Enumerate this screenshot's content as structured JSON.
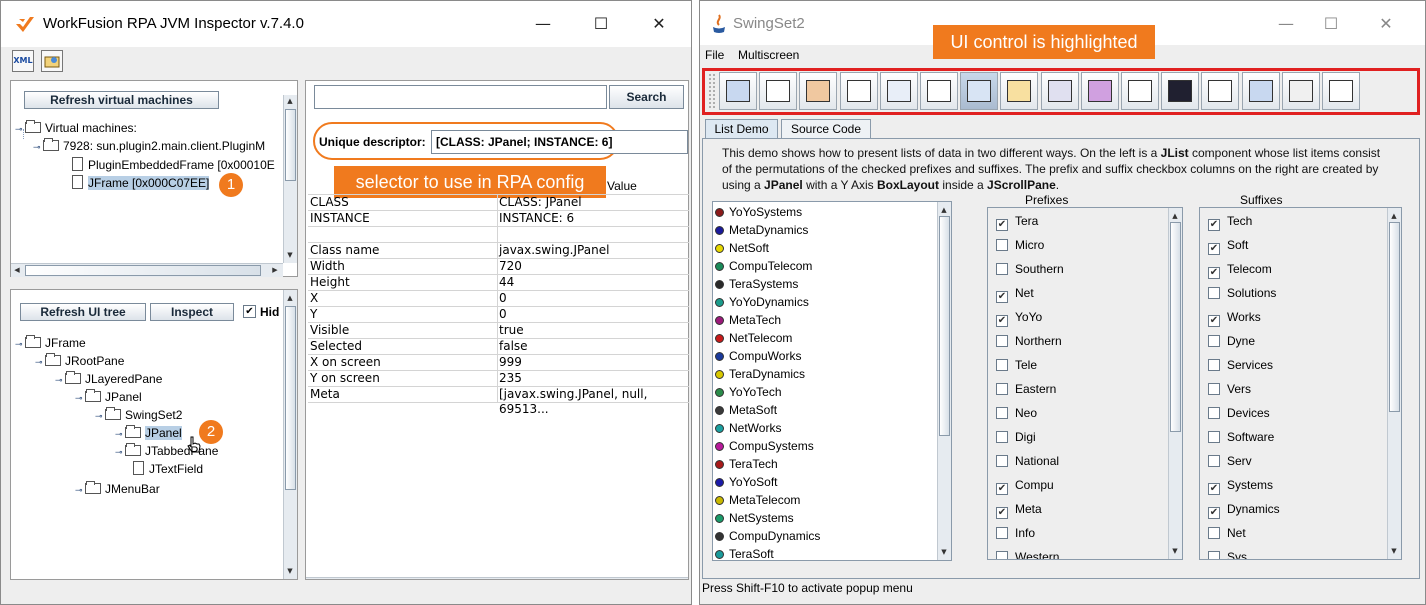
{
  "inspector": {
    "title": "WorkFusion RPA JVM Inspector v.7.4.0",
    "controls": {
      "minimize": "—",
      "maximize": "☐",
      "close": "✕"
    },
    "toolbar": {
      "xml_label": "XML",
      "open_label": ""
    },
    "vm_panel": {
      "refresh_vm_button": "Refresh virtual machines",
      "tree": [
        "Virtual machines:",
        "7928: sun.plugin2.main.client.PluginM",
        "PluginEmbeddedFrame [0x00010E",
        "JFrame [0x000C07EE]"
      ]
    },
    "ui_panel": {
      "refresh_ui_button": "Refresh UI tree",
      "inspect_button": "Inspect",
      "hide_checkbox_label": "Hid",
      "hide_checked": true,
      "tree": [
        "JFrame",
        "JRootPane",
        "JLayeredPane",
        "JPanel",
        "SwingSet2",
        "JPanel",
        "JTabbedPane",
        "JTextField",
        "JMenuBar"
      ]
    },
    "search": {
      "value": "",
      "button": "Search"
    },
    "descriptor": {
      "label": "Unique descriptor:",
      "value": "[CLASS: JPanel; INSTANCE: 6]"
    },
    "value_header": "Value",
    "properties": [
      {
        "key": "CLASS",
        "value": "CLASS: JPanel"
      },
      {
        "key": "INSTANCE",
        "value": "INSTANCE: 6"
      },
      {
        "key": "",
        "value": ""
      },
      {
        "key": "Class name",
        "value": "javax.swing.JPanel"
      },
      {
        "key": "Width",
        "value": "720"
      },
      {
        "key": "Height",
        "value": "44"
      },
      {
        "key": "X",
        "value": "0"
      },
      {
        "key": "Y",
        "value": "0"
      },
      {
        "key": "Visible",
        "value": "true"
      },
      {
        "key": "Selected",
        "value": "false"
      },
      {
        "key": "X on screen",
        "value": "999"
      },
      {
        "key": "Y on screen",
        "value": "235"
      },
      {
        "key": "Meta",
        "value": "[javax.swing.JPanel, null, 69513..."
      }
    ]
  },
  "annotations": {
    "badge1": "1",
    "badge2": "2",
    "selector_callout": "selector to use in RPA config",
    "highlight_callout": "UI control is highlighted",
    "accent_color": "#f07a1e",
    "highlight_color": "#e02020"
  },
  "swingset": {
    "title": "SwingSet2",
    "menu": [
      "File",
      "Multiscreen"
    ],
    "toolbar_icons": [
      "internal-frame-icon",
      "button-icon",
      "color-chooser-icon",
      "combobox-icon",
      "file-chooser-icon",
      "editor-pane-icon",
      "list-icon",
      "option-pane-icon",
      "progress-bar-icon",
      "scroll-pane-icon",
      "slider-icon",
      "split-pane-icon",
      "tabbed-pane-icon",
      "table-icon",
      "tooltip-icon",
      "tree-icon"
    ],
    "tabs": [
      "List Demo",
      "Source Code"
    ],
    "description_parts": [
      "This demo shows how to present lists of data in two different ways. On the left is a ",
      "JList",
      " component whose list items consist of the permutations of the checked prefixes and suffixes. The prefix and suffix checkbox columns on the right are created by using a ",
      "JPanel",
      " with a Y Axis ",
      "BoxLayout",
      " inside a ",
      "JScrollPane",
      "."
    ],
    "list_items": [
      {
        "label": "YoYoSystems",
        "color": "#8b1a1a"
      },
      {
        "label": "MetaDynamics",
        "color": "#1a1a9b"
      },
      {
        "label": "NetSoft",
        "color": "#e6d800"
      },
      {
        "label": "CompuTelecom",
        "color": "#1a8b5a"
      },
      {
        "label": "TeraSystems",
        "color": "#2a2a2a"
      },
      {
        "label": "YoYoDynamics",
        "color": "#1a9b8b"
      },
      {
        "label": "MetaTech",
        "color": "#9b1a7a"
      },
      {
        "label": "NetTelecom",
        "color": "#c81a1a"
      },
      {
        "label": "CompuWorks",
        "color": "#1a3a9b"
      },
      {
        "label": "TeraDynamics",
        "color": "#d8c800"
      },
      {
        "label": "YoYoTech",
        "color": "#2a8b4a"
      },
      {
        "label": "MetaSoft",
        "color": "#3a3a3a"
      },
      {
        "label": "NetWorks",
        "color": "#1aa0a0"
      },
      {
        "label": "CompuSystems",
        "color": "#b81a9b"
      },
      {
        "label": "TeraTech",
        "color": "#a81a1a"
      },
      {
        "label": "YoYoSoft",
        "color": "#1a1aa8"
      },
      {
        "label": "MetaTelecom",
        "color": "#c8b800"
      },
      {
        "label": "NetSystems",
        "color": "#1a9b6a"
      },
      {
        "label": "CompuDynamics",
        "color": "#333333"
      },
      {
        "label": "TeraSoft",
        "color": "#1a9b9b"
      }
    ],
    "prefixes_header": "Prefixes",
    "suffixes_header": "Suffixes",
    "prefixes": [
      {
        "label": "Tera",
        "checked": true
      },
      {
        "label": "Micro",
        "checked": false
      },
      {
        "label": "Southern",
        "checked": false
      },
      {
        "label": "Net",
        "checked": true
      },
      {
        "label": "YoYo",
        "checked": true
      },
      {
        "label": "Northern",
        "checked": false
      },
      {
        "label": "Tele",
        "checked": false
      },
      {
        "label": "Eastern",
        "checked": false
      },
      {
        "label": "Neo",
        "checked": false
      },
      {
        "label": "Digi",
        "checked": false
      },
      {
        "label": "National",
        "checked": false
      },
      {
        "label": "Compu",
        "checked": true
      },
      {
        "label": "Meta",
        "checked": true
      },
      {
        "label": "Info",
        "checked": false
      },
      {
        "label": "Western",
        "checked": false
      }
    ],
    "suffixes": [
      {
        "label": "Tech",
        "checked": true
      },
      {
        "label": "Soft",
        "checked": true
      },
      {
        "label": "Telecom",
        "checked": true
      },
      {
        "label": "Solutions",
        "checked": false
      },
      {
        "label": "Works",
        "checked": true
      },
      {
        "label": "Dyne",
        "checked": false
      },
      {
        "label": "Services",
        "checked": false
      },
      {
        "label": "Vers",
        "checked": false
      },
      {
        "label": "Devices",
        "checked": false
      },
      {
        "label": "Software",
        "checked": false
      },
      {
        "label": "Serv",
        "checked": false
      },
      {
        "label": "Systems",
        "checked": true
      },
      {
        "label": "Dynamics",
        "checked": true
      },
      {
        "label": "Net",
        "checked": false
      },
      {
        "label": "Sys",
        "checked": false
      }
    ],
    "status_bar": "Press Shift-F10 to activate popup menu"
  }
}
